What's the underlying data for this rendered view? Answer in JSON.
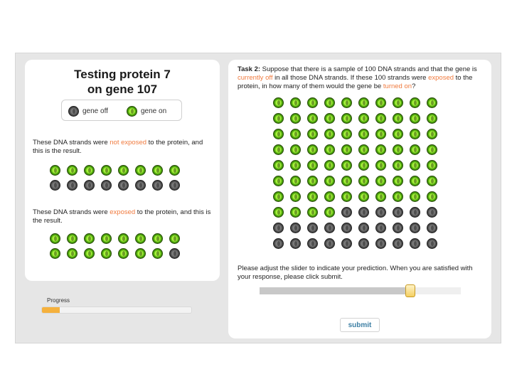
{
  "left_panel": {
    "title_line1": "Testing protein 7",
    "title_line2": "on gene 107",
    "legend": {
      "off_label": "gene off",
      "on_label": "gene on"
    },
    "not_exposed": {
      "text_before": "These DNA strands were ",
      "highlight": "not exposed",
      "text_after": " to the protein, and this is the result.",
      "grid": [
        [
          "on",
          "on",
          "on",
          "on",
          "on",
          "on",
          "on",
          "on"
        ],
        [
          "off",
          "off",
          "off",
          "off",
          "off",
          "off",
          "off",
          "off"
        ]
      ]
    },
    "exposed": {
      "text_before": "These DNA strands were ",
      "highlight": "exposed",
      "text_after": " to the protein, and this is the result.",
      "grid": [
        [
          "on",
          "on",
          "on",
          "on",
          "on",
          "on",
          "on",
          "on"
        ],
        [
          "on",
          "on",
          "on",
          "on",
          "on",
          "on",
          "on",
          "off"
        ]
      ]
    }
  },
  "progress": {
    "label": "Progress",
    "value_percent": 12
  },
  "task": {
    "label": "Task 2:",
    "text1": " Suppose that there is a sample of 100 DNA strands and that the gene is ",
    "hl1": "currently off",
    "text2": " in all those DNA strands. If these 100 strands were ",
    "hl2": "exposed",
    "text3": " to the protein, in how many of them would the gene be ",
    "hl3": "turned on",
    "text4": "?",
    "grid_rows": 10,
    "grid_cols": 10,
    "on_count": 74
  },
  "instructions": "Please adjust the slider to indicate your prediction. When you are satisfied with your response, please click submit.",
  "slider": {
    "value_percent": 75
  },
  "submit_label": "submit",
  "colors": {
    "highlight": "#f07b3f",
    "gene_on": "#7ad11f",
    "gene_off": "#555555",
    "progress": "#f5b13d",
    "submit_text": "#3d7fa4"
  }
}
